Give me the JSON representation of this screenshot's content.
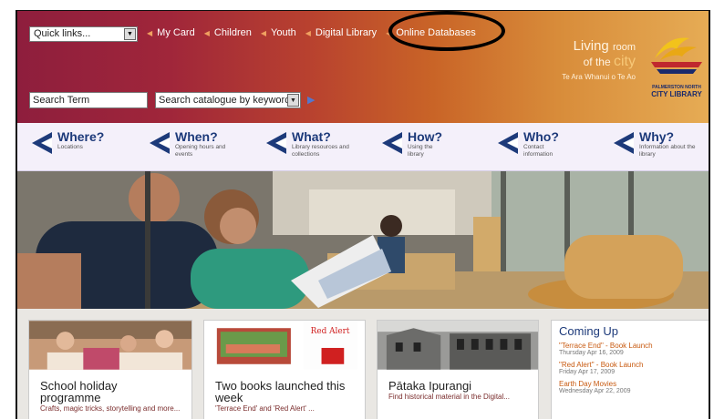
{
  "header": {
    "quick_links": "Quick links...",
    "top_links": [
      "My Card",
      "Children",
      "Youth",
      "Digital Library",
      "Online Databases"
    ],
    "tagline_line1_a": "Living",
    "tagline_line1_b": "room",
    "tagline_line2_a": "of the",
    "tagline_line2_b": "city",
    "tagline_line3": "Te Ara Whanui o Te Ao",
    "logo_sub": "PALMERSTON NORTH",
    "logo_name": "CITY LIBRARY",
    "search_placeholder": "Search Term",
    "search_mode": "Search catalogue by keyword"
  },
  "nav": [
    {
      "title": "Where?",
      "sub": "Locations"
    },
    {
      "title": "When?",
      "sub": "Opening hours and events"
    },
    {
      "title": "What?",
      "sub": "Library resources and collections"
    },
    {
      "title": "How?",
      "sub": "Using the library"
    },
    {
      "title": "Who?",
      "sub": "Contact information"
    },
    {
      "title": "Why?",
      "sub": "Information about the library"
    }
  ],
  "cards": [
    {
      "title": "School holiday programme",
      "desc": "Crafts, magic tricks, storytelling and more..."
    },
    {
      "title": "Two books launched this week",
      "desc": "'Terrace End' and 'Red Alert' ..."
    },
    {
      "title": "Pātaka Ipurangi",
      "desc": "Find historical material in the Digital..."
    }
  ],
  "coming_up": {
    "heading": "Coming Up",
    "events": [
      {
        "title": "\"Terrace End\" - Book Launch",
        "date": "Thursday Apr 16, 2009"
      },
      {
        "title": "\"Red Alert\" - Book Launch",
        "date": "Friday Apr 17, 2009"
      },
      {
        "title": "Earth Day Movies",
        "date": "Wednesday Apr 22, 2009"
      }
    ]
  },
  "card_image_text": "Red Alert",
  "colors": {
    "nav_title": "#1d3a7a",
    "link_tri": "#f0a060",
    "event": "#c85a10"
  }
}
